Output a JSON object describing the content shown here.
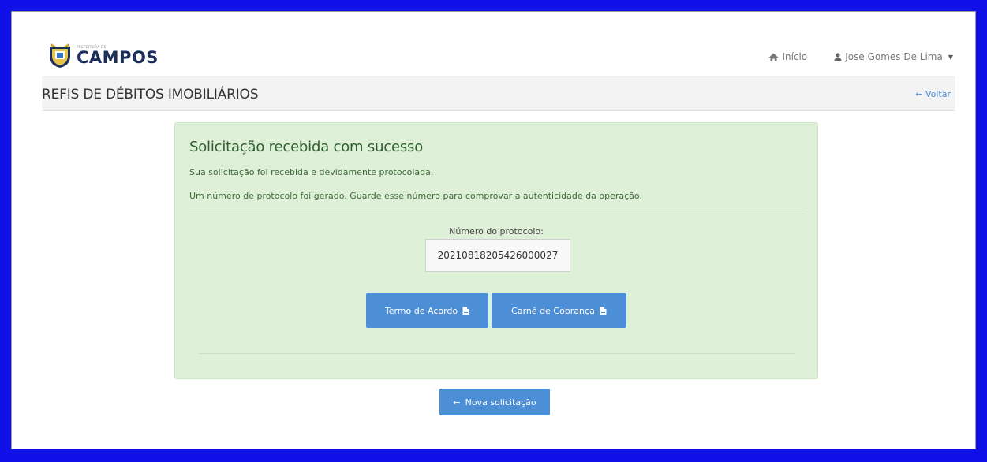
{
  "brand": {
    "small_text": "PREFEITURA DE",
    "name": "CAMPOS"
  },
  "topnav": {
    "home_label": "Início",
    "user_label": "Jose Gomes De Lima"
  },
  "page": {
    "title": "REFIS DE DÉBITOS IMOBILIÁRIOS",
    "back_label": "Voltar"
  },
  "success": {
    "heading": "Solicitação recebida com sucesso",
    "message1": "Sua solicitação foi recebida e devidamente protocolada.",
    "message2": "Um número de protocolo foi gerado. Guarde esse número para comprovar a autenticidade da operação.",
    "protocol_label": "Número do protocolo:",
    "protocol_number": "20210818205426000027",
    "button_termo": "Termo de Acordo",
    "button_carne": "Carnê de Cobrança"
  },
  "actions": {
    "new_request_label": "Nova solicitação"
  },
  "colors": {
    "outer_frame": "#1010e8",
    "success_bg": "#dff0d8",
    "primary_button": "#4d8fd6",
    "heading_green": "#2f5f2f"
  },
  "icons": [
    "home-icon",
    "user-icon",
    "caret-down-icon",
    "arrow-left-icon",
    "file-icon"
  ]
}
